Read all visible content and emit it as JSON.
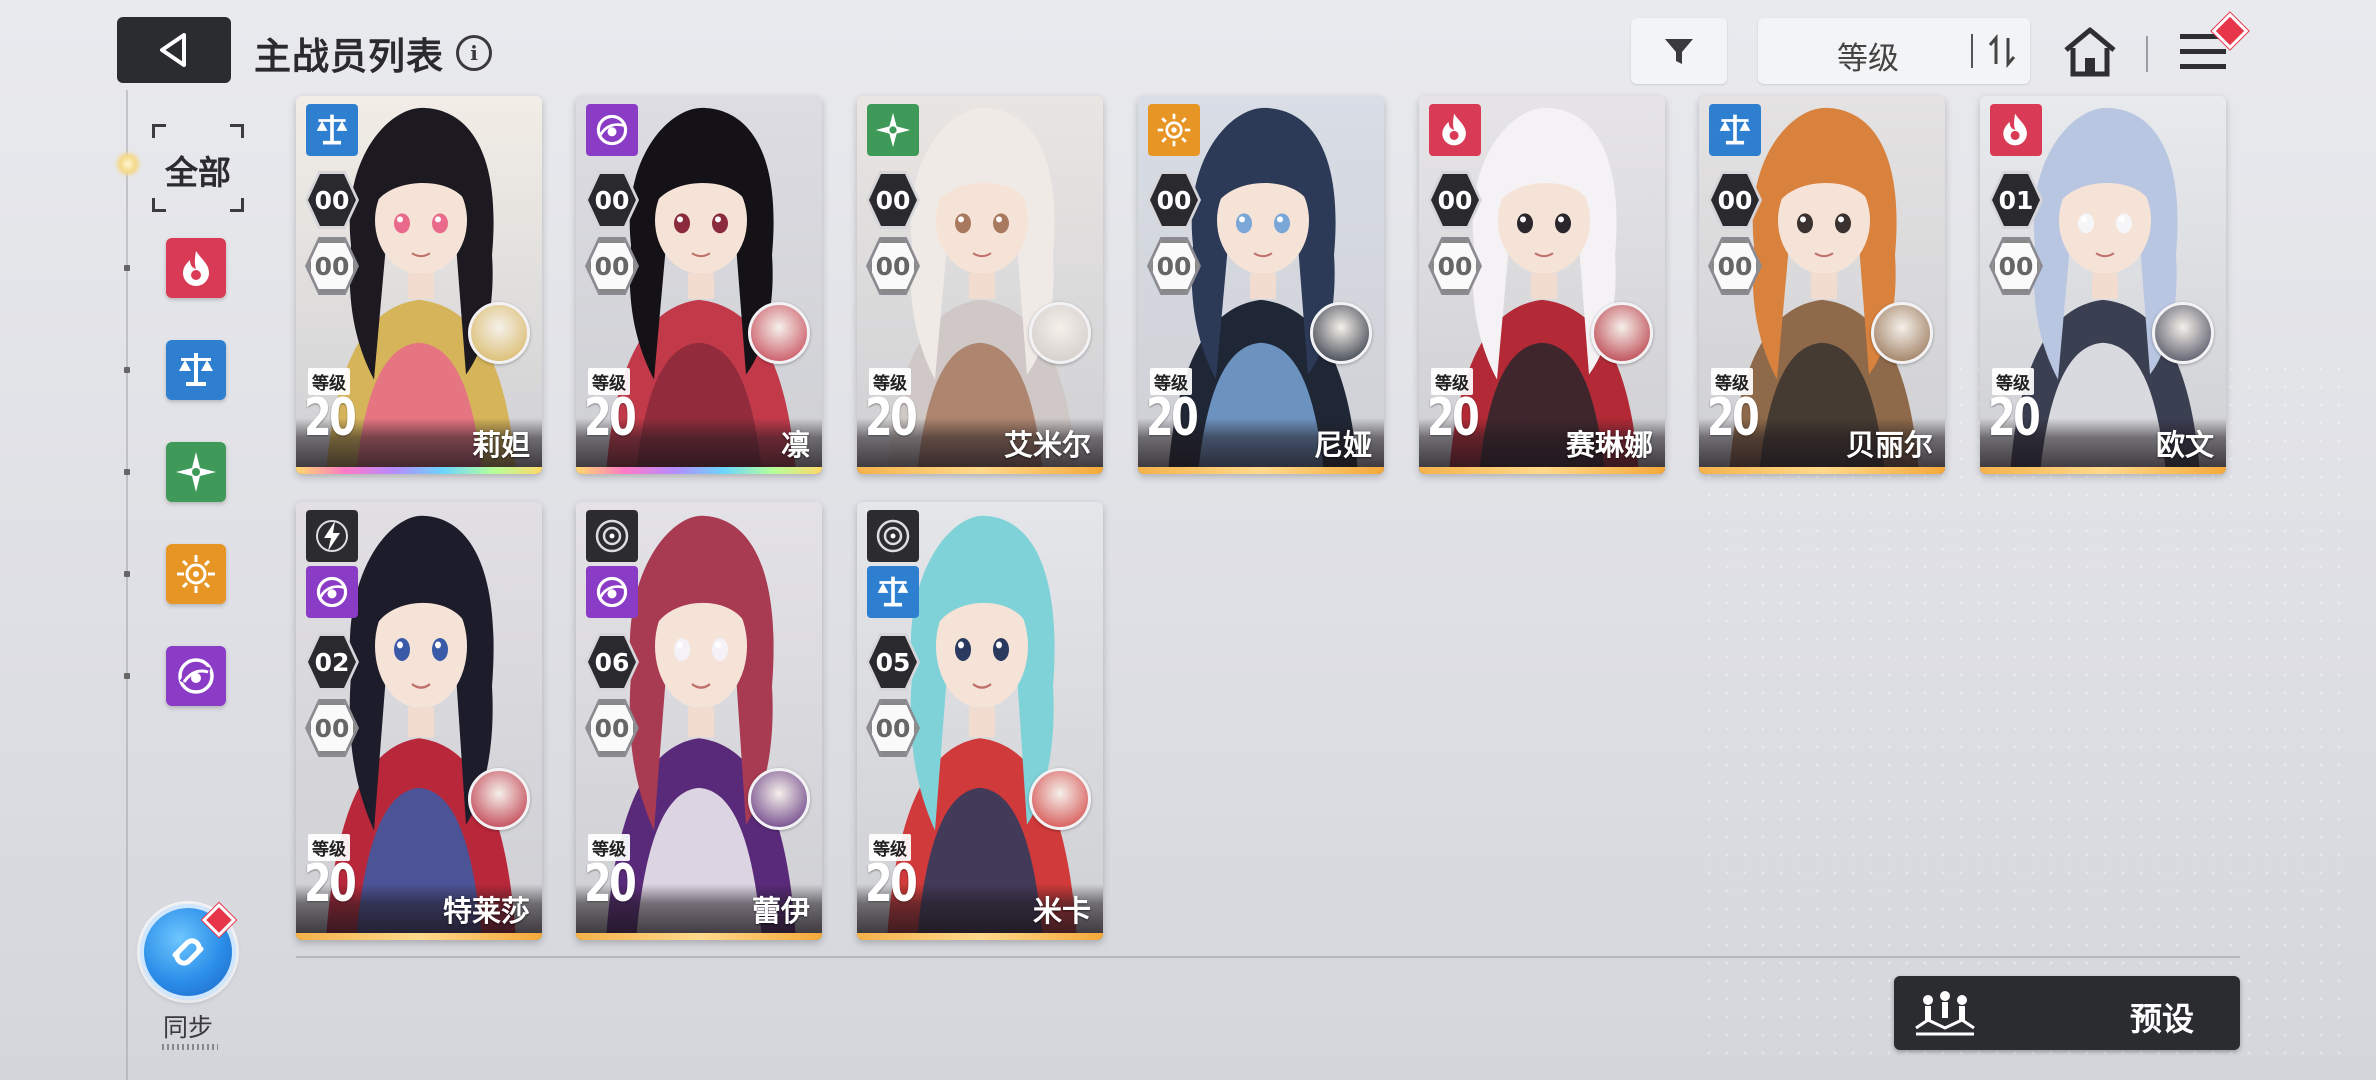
{
  "header": {
    "title": "主战员列表",
    "info_glyph": "i",
    "sort_label": "等级"
  },
  "sidebar": {
    "all_label": "全部",
    "filters": [
      {
        "name": "fire",
        "color": "#d93a55"
      },
      {
        "name": "balance",
        "color": "#2f7fd0"
      },
      {
        "name": "star",
        "color": "#3f9a5a"
      },
      {
        "name": "sun",
        "color": "#e79524"
      },
      {
        "name": "eye",
        "color": "#8a3cc6"
      }
    ],
    "sync_label": "同步"
  },
  "cards": [
    {
      "name": "莉妲",
      "level": "20",
      "level_tag": "等级",
      "element": "balance",
      "element_color": "#2f7fd0",
      "rank1": "00",
      "rank2": "00",
      "strip": "rainbow",
      "palette": [
        "#f2ede6",
        "#1c1a20",
        "#e96a8a",
        "#d6b45a"
      ]
    },
    {
      "name": "凛",
      "level": "20",
      "level_tag": "等级",
      "element": "eye",
      "element_color": "#8a3cc6",
      "rank1": "00",
      "rank2": "00",
      "strip": "rainbow",
      "palette": [
        "#dcdce2",
        "#141216",
        "#8a2a3a",
        "#c23a4a"
      ]
    },
    {
      "name": "艾米尔",
      "level": "20",
      "level_tag": "等级",
      "element": "star",
      "element_color": "#3f9a5a",
      "rank1": "00",
      "rank2": "00",
      "strip": "gold",
      "palette": [
        "#e9e5e2",
        "#f0eae6",
        "#a8795e",
        "#cfc8c6"
      ]
    },
    {
      "name": "尼娅",
      "level": "20",
      "level_tag": "等级",
      "element": "sun",
      "element_color": "#e79524",
      "rank1": "00",
      "rank2": "00",
      "strip": "gold",
      "palette": [
        "#d8dde6",
        "#2c3a58",
        "#7aa6d8",
        "#1f2736"
      ]
    },
    {
      "name": "赛琳娜",
      "level": "20",
      "level_tag": "等级",
      "element": "fire",
      "element_color": "#d93a55",
      "rank1": "00",
      "rank2": "00",
      "strip": "gold",
      "palette": [
        "#e6e4e6",
        "#f4f2f4",
        "#2a262c",
        "#b32a36"
      ]
    },
    {
      "name": "贝丽尔",
      "level": "20",
      "level_tag": "等级",
      "element": "balance",
      "element_color": "#2f7fd0",
      "rank1": "00",
      "rank2": "00",
      "strip": "gold",
      "palette": [
        "#e4e2e2",
        "#d8823e",
        "#3a322e",
        "#8f6a4a"
      ]
    },
    {
      "name": "欧文",
      "level": "20",
      "level_tag": "等级",
      "element": "fire",
      "element_color": "#d93a55",
      "rank1": "01",
      "rank2": "00",
      "strip": "gold",
      "palette": [
        "#e8eaee",
        "#b9c6e2",
        "#f6f6f8",
        "#3b3f52"
      ]
    },
    {
      "name": "特莱莎",
      "level": "20",
      "level_tag": "等级",
      "element": "eye",
      "element_color": "#8a3cc6",
      "weapon": "bolt",
      "rank1": "02",
      "rank2": "00",
      "strip": "gold",
      "palette": [
        "#e1dfe3",
        "#1d1c2a",
        "#3a5aa8",
        "#b9283a"
      ]
    },
    {
      "name": "蕾伊",
      "level": "20",
      "level_tag": "等级",
      "element": "eye",
      "element_color": "#8a3cc6",
      "weapon": "target",
      "rank1": "06",
      "rank2": "00",
      "strip": "gold",
      "palette": [
        "#e4e2e6",
        "#a83a52",
        "#f4f2f6",
        "#5a2a7a"
      ]
    },
    {
      "name": "米卡",
      "level": "20",
      "level_tag": "等级",
      "element": "balance",
      "element_color": "#2f7fd0",
      "weapon": "target",
      "rank1": "05",
      "rank2": "00",
      "strip": "gold",
      "palette": [
        "#e4e6ea",
        "#7ed2d8",
        "#2a3a5e",
        "#d03a3a"
      ]
    }
  ],
  "footer": {
    "preset_label": "预设"
  },
  "colors": {
    "dark_button": "#2b2c30",
    "badge_red": "#e7354a",
    "sync_blue": "#2b8ee8"
  }
}
